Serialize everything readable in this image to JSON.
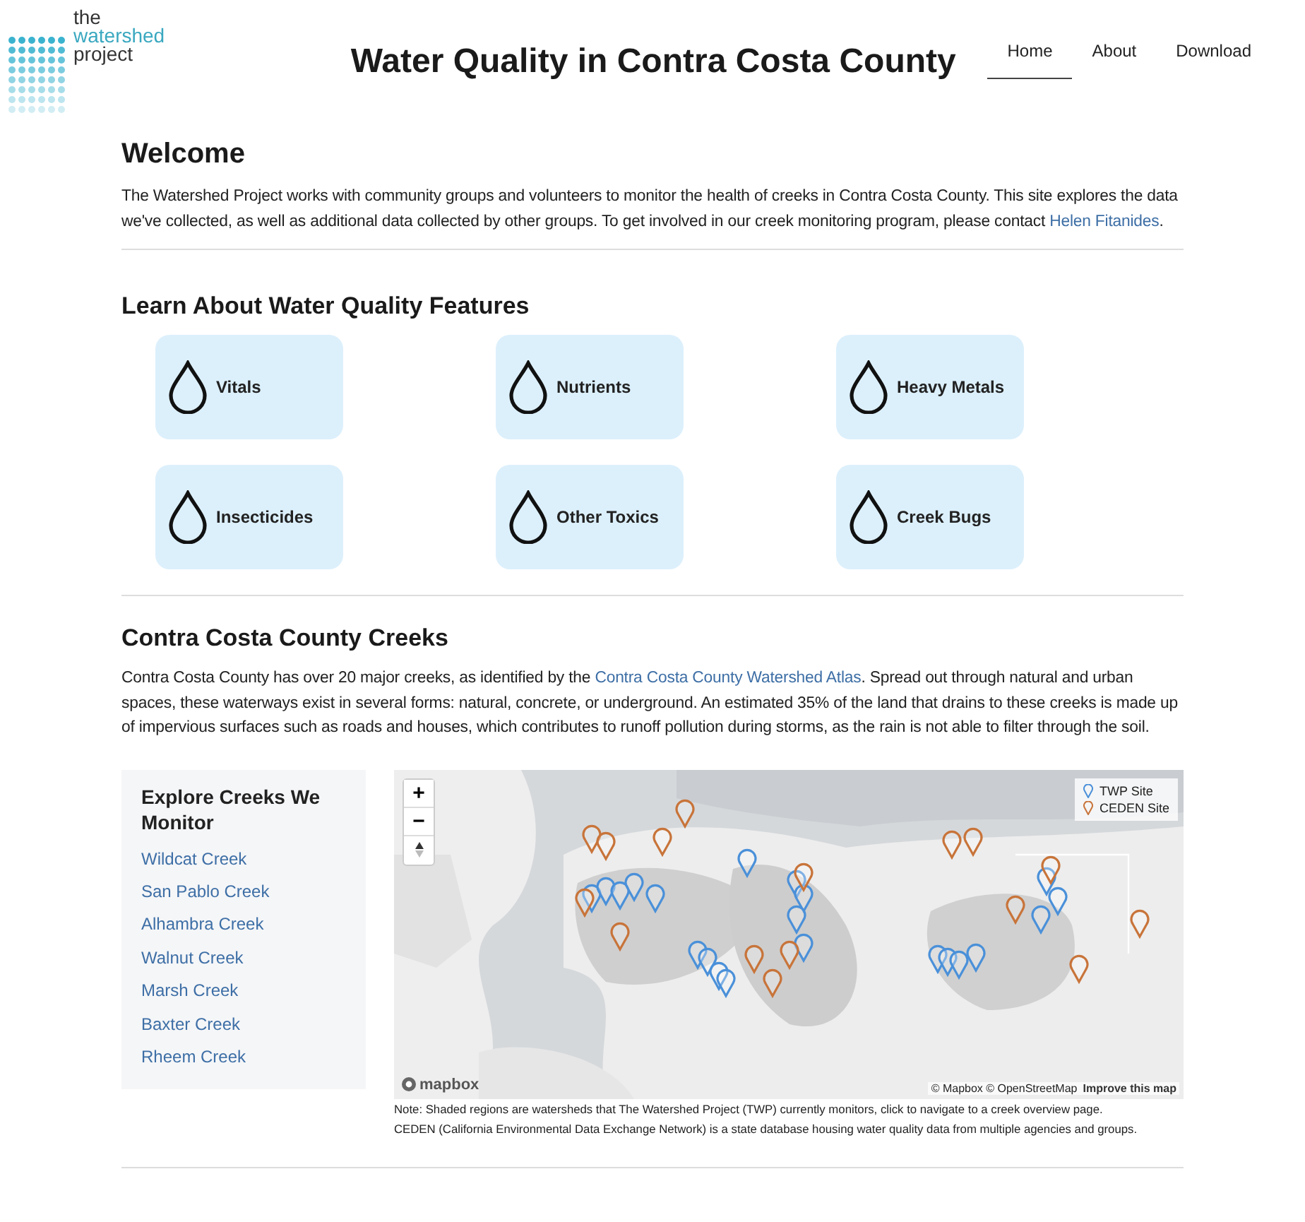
{
  "logo": {
    "lines": [
      "the",
      "watershed",
      "project"
    ]
  },
  "title": "Water Quality in Contra Costa County",
  "nav": [
    {
      "label": "Home",
      "selected": true
    },
    {
      "label": "About",
      "selected": false
    },
    {
      "label": "Download",
      "selected": false
    }
  ],
  "welcome": {
    "heading": "Welcome",
    "text": "The Watershed Project works with community groups and volunteers to monitor the health of creeks in Contra Costa County. This site explores the data we've collected, as well as additional data collected by other groups. To get involved in our creek monitoring program, please contact ",
    "link": "Helen Fitanides",
    "after": "."
  },
  "features": {
    "heading": "Learn About Water Quality Features",
    "cards": [
      {
        "label": "Vitals"
      },
      {
        "label": "Nutrients"
      },
      {
        "label": "Heavy Metals"
      },
      {
        "label": "Insecticides"
      },
      {
        "label": "Other Toxics"
      },
      {
        "label": "Creek Bugs"
      }
    ]
  },
  "creeks": {
    "heading": "Contra Costa County Creeks",
    "before": "Contra Costa County has over 20 major creeks, as identified by the ",
    "link": "Contra Costa County Watershed Atlas",
    "after": ". Spread out through natural and urban spaces, these waterways exist in several forms: natural, concrete, or underground. An estimated 35% of the land that drains to these creeks is made up of impervious surfaces such as roads and houses, which contributes to runoff pollution during storms, as the rain is not able to filter through the soil."
  },
  "sidebar": {
    "heading": "Explore Creeks We Monitor",
    "items": [
      "Wildcat Creek",
      "San Pablo Creek",
      "Alhambra Creek",
      "Walnut Creek",
      "Marsh Creek",
      "Baxter Creek",
      "Rheem Creek"
    ]
  },
  "map": {
    "kind": "picture",
    "zoom_in": "+",
    "zoom_out": "−",
    "legend": [
      {
        "label": "TWP Site",
        "color": "#4a90d9"
      },
      {
        "label": "CEDEN Site",
        "color": "#c8743a"
      }
    ],
    "logo": "mapbox",
    "attribution": "© Mapbox © OpenStreetMap",
    "improve": "Improve this map"
  },
  "note": [
    "Note: Shaded regions are watersheds that The Watershed Project (TWP) currently monitors, click to navigate to a creek overview page.",
    "CEDEN (California Environmental Data Exchange Network) is a state database housing water quality data from multiple agencies and groups."
  ]
}
